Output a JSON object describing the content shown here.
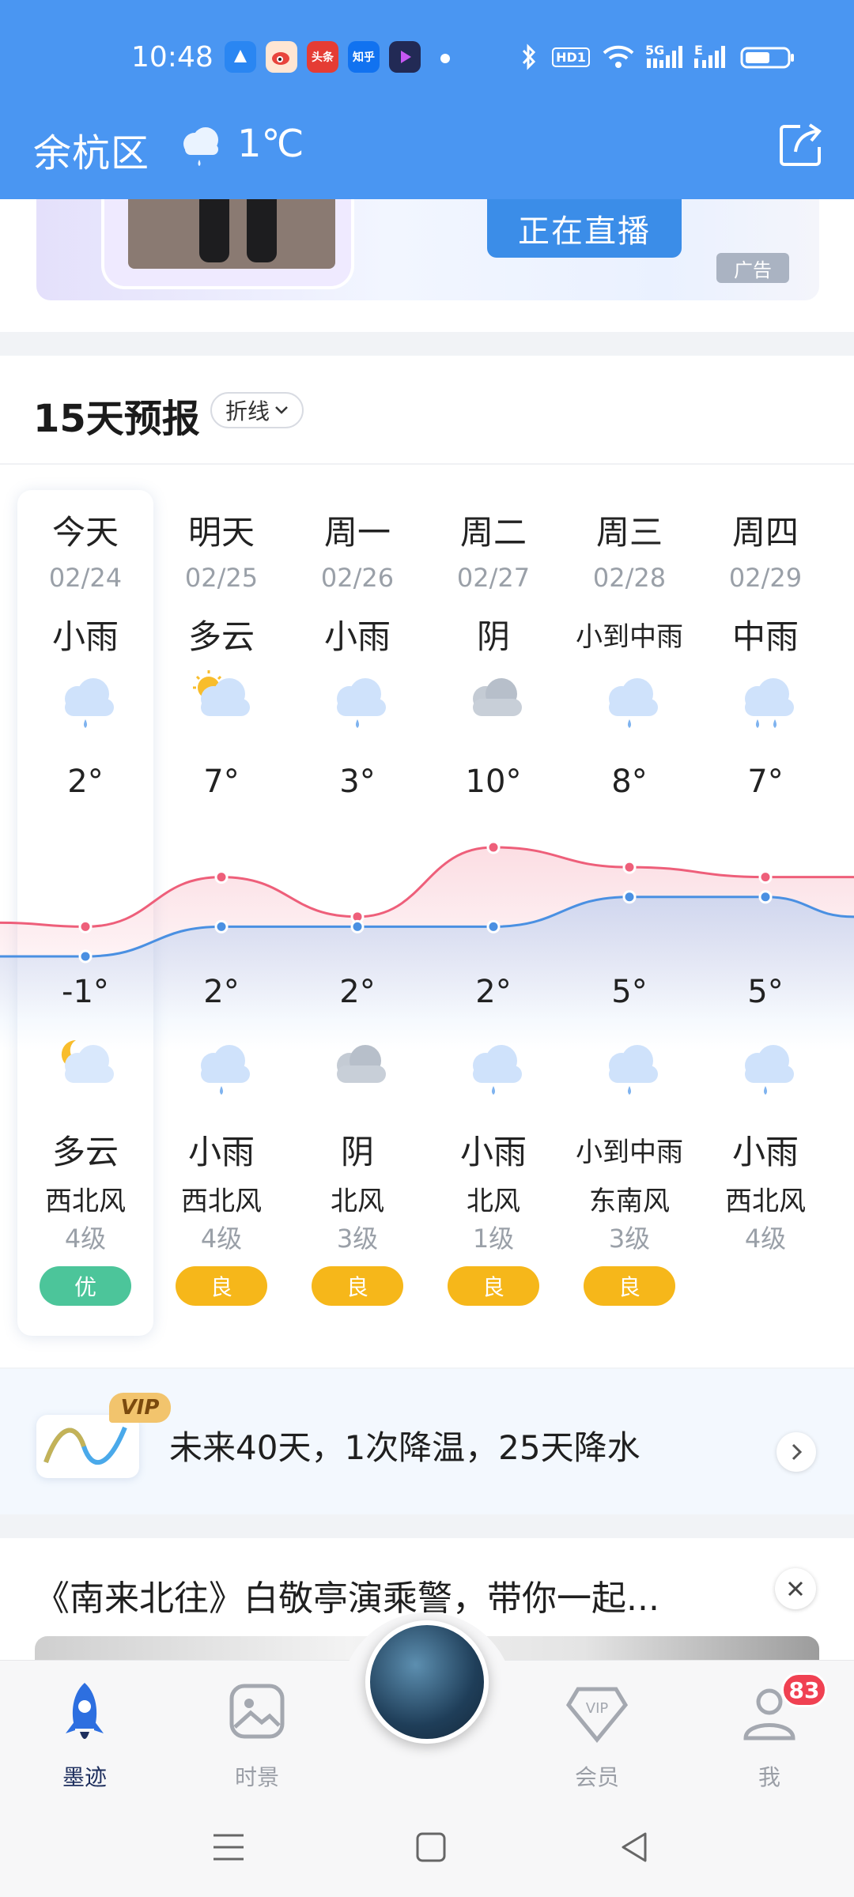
{
  "status_bar": {
    "time": "10:48",
    "apps": [
      {
        "name": "qq-browser-icon",
        "label": "",
        "color": "#2a86f2"
      },
      {
        "name": "weibo-icon",
        "label": "",
        "color": "#e8443c"
      },
      {
        "name": "toutiao-icon",
        "label": "头条",
        "color": "#e53c34"
      },
      {
        "name": "zhihu-icon",
        "label": "知乎",
        "color": "#1172f0"
      },
      {
        "name": "video-app-icon",
        "label": "",
        "color": "#222a55"
      }
    ],
    "hd_label": "HD1",
    "net_label": "5G",
    "net2_label": "E"
  },
  "header": {
    "location": "余杭区",
    "temperature": "1℃",
    "weather_icon": "cloud-rain-icon",
    "share_icon": "share-icon"
  },
  "ad": {
    "button_label": "正在直播",
    "tag": "广告"
  },
  "forecast": {
    "title": "15天预报",
    "mode": "折线",
    "days": [
      {
        "day": "今天",
        "date": "02/24",
        "day_weather": "小雨",
        "day_icon": "cloud-rain-icon",
        "high": "2°",
        "low": "-1°",
        "night_icon": "moon-cloud-icon",
        "night_weather": "多云",
        "wind": "西北风",
        "level": "4级",
        "aqi": "优",
        "aqi_color": "#4cc59a"
      },
      {
        "day": "明天",
        "date": "02/25",
        "day_weather": "多云",
        "day_icon": "sun-cloud-icon",
        "high": "7°",
        "low": "2°",
        "night_icon": "cloud-rain-icon",
        "night_weather": "小雨",
        "wind": "西北风",
        "level": "4级",
        "aqi": "良",
        "aqi_color": "#f6b71a"
      },
      {
        "day": "周一",
        "date": "02/26",
        "day_weather": "小雨",
        "day_icon": "cloud-rain-icon",
        "high": "3°",
        "low": "2°",
        "night_icon": "overcast-icon",
        "night_weather": "阴",
        "wind": "北风",
        "level": "3级",
        "aqi": "良",
        "aqi_color": "#f6b71a"
      },
      {
        "day": "周二",
        "date": "02/27",
        "day_weather": "阴",
        "day_icon": "overcast-icon",
        "high": "10°",
        "low": "2°",
        "night_icon": "cloud-rain-icon",
        "night_weather": "小雨",
        "wind": "北风",
        "level": "1级",
        "aqi": "良",
        "aqi_color": "#f6b71a"
      },
      {
        "day": "周三",
        "date": "02/28",
        "day_weather": "小到中雨",
        "day_icon": "cloud-rain-icon",
        "high": "8°",
        "low": "5°",
        "night_icon": "cloud-rain-icon",
        "night_weather": "小到中雨",
        "wind": "东南风",
        "level": "3级",
        "aqi": "良",
        "aqi_color": "#f6b71a"
      },
      {
        "day": "周四",
        "date": "02/29",
        "day_weather": "中雨",
        "day_icon": "cloud-heavy-rain-icon",
        "high": "7°",
        "low": "5°",
        "night_icon": "cloud-rain-icon",
        "night_weather": "小雨",
        "wind": "西北风",
        "level": "4级",
        "aqi": "",
        "aqi_color": ""
      }
    ],
    "high_color": "#ee5f7a",
    "low_color": "#4a90e2"
  },
  "forty_day": {
    "vip": "VIP",
    "text": "未来40天，1次降温，25天降水"
  },
  "news": {
    "title": "《南来北往》白敬亭演乘警，带你一起..."
  },
  "bottom_nav": {
    "items": [
      {
        "label": "墨迹",
        "icon": "rocket-icon"
      },
      {
        "label": "时景",
        "icon": "image-icon"
      },
      {
        "label": "会员",
        "icon": "vip-diamond-icon"
      },
      {
        "label": "我",
        "icon": "user-icon"
      }
    ],
    "badge": "83"
  }
}
